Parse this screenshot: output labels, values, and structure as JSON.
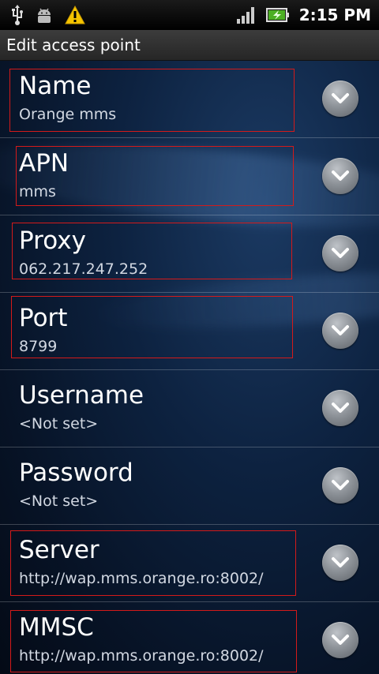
{
  "status_bar": {
    "time": "2:15 PM",
    "icons": [
      "usb-icon",
      "android-debug-icon",
      "warning-icon",
      "signal-icon",
      "battery-charging-icon"
    ]
  },
  "title": "Edit access point",
  "settings": [
    {
      "label": "Name",
      "value": "Orange mms"
    },
    {
      "label": "APN",
      "value": "mms"
    },
    {
      "label": "Proxy",
      "value": "062.217.247.252"
    },
    {
      "label": "Port",
      "value": "8799"
    },
    {
      "label": "Username",
      "value": "<Not set>"
    },
    {
      "label": "Password",
      "value": "<Not set>"
    },
    {
      "label": "Server",
      "value": "http://wap.mms.orange.ro:8002/"
    },
    {
      "label": "MMSC",
      "value": "http://wap.mms.orange.ro:8002/"
    }
  ],
  "colors": {
    "highlight_border": "#d41a1a",
    "warning_yellow": "#f5c400",
    "battery_green": "#4caf23"
  }
}
